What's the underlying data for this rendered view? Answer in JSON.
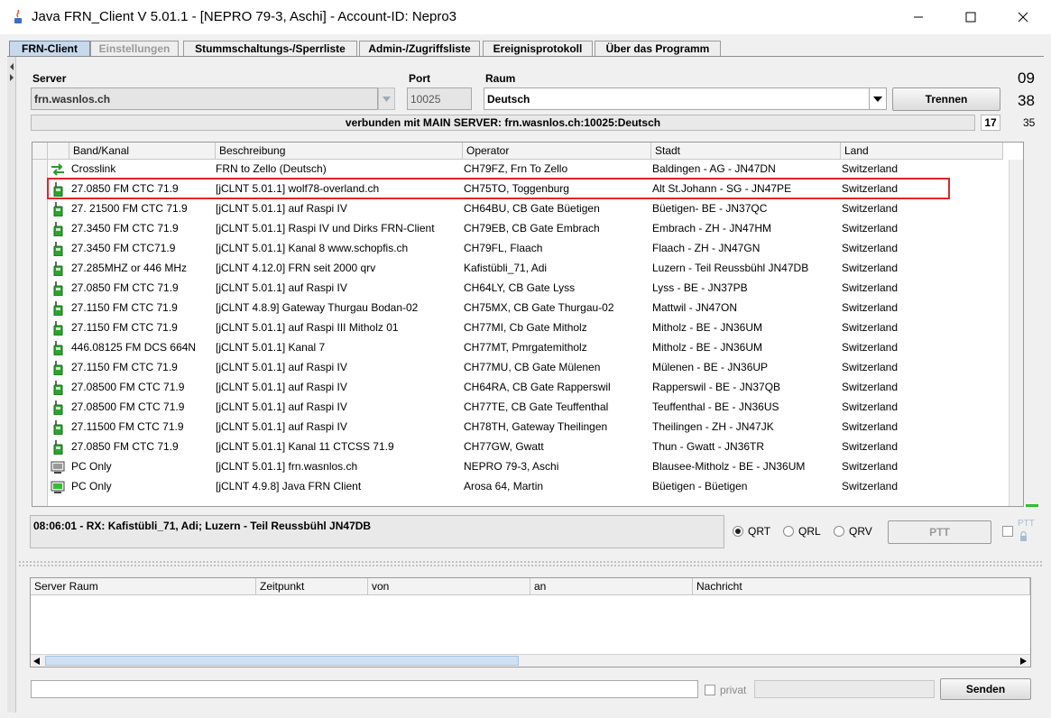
{
  "window": {
    "title": "Java FRN_Client V 5.01.1 - [NEPRO 79-3, Aschi] - Account-ID: Nepro3"
  },
  "tabs": [
    {
      "label": "FRN-Client",
      "state": "active"
    },
    {
      "label": "Einstellungen",
      "state": "disabled"
    },
    {
      "label": "Stummschaltungs-/Sperrliste",
      "state": "normal"
    },
    {
      "label": "Admin-/Zugriffsliste",
      "state": "normal"
    },
    {
      "label": "Ereignisprotokoll",
      "state": "normal"
    },
    {
      "label": "Über das Programm",
      "state": "normal"
    }
  ],
  "connection": {
    "server_label": "Server",
    "server_value": "frn.wasnlos.ch",
    "port_label": "Port",
    "port_value": "10025",
    "room_label": "Raum",
    "room_value": "Deutsch",
    "disconnect_button": "Trennen",
    "status_text": "verbunden mit  MAIN SERVER: frn.wasnlos.ch:10025:Deutsch",
    "user_count": "17",
    "clock_hours": "09",
    "clock_minutes": "38",
    "clock_seconds": "35"
  },
  "server_table": {
    "columns": [
      "Band/Kanal",
      "Beschreibung",
      "Operator",
      "Stadt",
      "Land"
    ],
    "rows": [
      {
        "icon": "crosslink-icon",
        "band": "Crosslink",
        "description": "FRN to Zello (Deutsch)",
        "operator": "CH79FZ, Frn To Zello",
        "city": "Baldingen - AG - JN47DN",
        "country": "Switzerland"
      },
      {
        "icon": "radio-gateway-icon",
        "band": "27.0850 FM CTC 71.9",
        "description": "[jCLNT 5.01.1] wolf78-overland.ch",
        "operator": "CH75TO, Toggenburg",
        "city": "Alt St.Johann - SG - JN47PE",
        "country": "Switzerland"
      },
      {
        "icon": "radio-gateway-icon",
        "band": "27. 21500 FM CTC 71.9",
        "description": "[jCLNT 5.01.1] auf Raspi IV",
        "operator": "CH64BU, CB Gate Büetigen",
        "city": "Büetigen- BE - JN37QC",
        "country": "Switzerland"
      },
      {
        "icon": "radio-gateway-icon",
        "band": "27.3450 FM CTC 71.9",
        "description": "[jCLNT 5.01.1] Raspi IV und Dirks FRN-Client",
        "operator": "CH79EB, CB Gate Embrach",
        "city": "Embrach - ZH - JN47HM",
        "country": "Switzerland"
      },
      {
        "icon": "radio-gateway-icon",
        "band": "27.3450 FM CTC71.9",
        "description": "[jCLNT 5.01.1] Kanal 8  www.schopfis.ch",
        "operator": "CH79FL, Flaach",
        "city": "Flaach - ZH - JN47GN",
        "country": "Switzerland"
      },
      {
        "icon": "radio-gateway-icon",
        "band": "27.285MHZ or 446 MHz",
        "description": "[jCLNT 4.12.0] FRN seit 2000 qrv",
        "operator": "Kafistübli_71, Adi",
        "city": "Luzern - Teil Reussbühl JN47DB",
        "country": "Switzerland"
      },
      {
        "icon": "radio-gateway-icon",
        "band": "27.0850 FM CTC 71.9",
        "description": "[jCLNT 5.01.1] auf Raspi IV",
        "operator": "CH64LY, CB Gate Lyss",
        "city": "Lyss - BE - JN37PB",
        "country": "Switzerland"
      },
      {
        "icon": "radio-gateway-icon",
        "band": "27.1150 FM CTC 71.9",
        "description": "[jCLNT 4.8.9] Gateway Thurgau Bodan-02",
        "operator": "CH75MX, CB Gate Thurgau-02",
        "city": "Mattwil - JN47ON",
        "country": "Switzerland"
      },
      {
        "icon": "radio-gateway-icon",
        "band": "27.1150 FM CTC 71.9",
        "description": "[jCLNT 5.01.1] auf Raspi III  Mitholz 01",
        "operator": "CH77MI, Cb Gate Mitholz",
        "city": "Mitholz - BE - JN36UM",
        "country": "Switzerland"
      },
      {
        "icon": "radio-gateway-icon",
        "band": "446.08125 FM DCS 664N",
        "description": "[jCLNT 5.01.1] Kanal 7",
        "operator": "CH77MT, Pmrgatemitholz",
        "city": "Mitholz - BE - JN36UM",
        "country": "Switzerland"
      },
      {
        "icon": "radio-gateway-icon",
        "band": "27.1150 FM CTC 71.9",
        "description": "[jCLNT 5.01.1] auf Raspi IV",
        "operator": "CH77MU, CB Gate Mülenen",
        "city": "Mülenen - BE - JN36UP",
        "country": "Switzerland"
      },
      {
        "icon": "radio-gateway-icon",
        "band": "27.08500 FM CTC 71.9",
        "description": "[jCLNT 5.01.1] auf Raspi IV",
        "operator": "CH64RA, CB Gate Rapperswil",
        "city": "Rapperswil - BE - JN37QB",
        "country": "Switzerland"
      },
      {
        "icon": "radio-gateway-icon",
        "band": "27.08500 FM CTC 71.9",
        "description": "[jCLNT 5.01.1] auf Raspi IV",
        "operator": "CH77TE, CB Gate Teuffenthal",
        "city": "Teuffenthal - BE - JN36US",
        "country": "Switzerland"
      },
      {
        "icon": "radio-gateway-icon",
        "band": "27.11500 FM CTC 71.9",
        "description": "[jCLNT 5.01.1] auf Raspi IV",
        "operator": "CH78TH, Gateway Theilingen",
        "city": "Theilingen - ZH - JN47JK",
        "country": "Switzerland"
      },
      {
        "icon": "radio-gateway-icon",
        "band": "27.0850 FM CTC 71.9",
        "description": "[jCLNT 5.01.1] Kanal 11 CTCSS 71.9",
        "operator": "CH77GW, Gwatt",
        "city": "Thun - Gwatt - JN36TR",
        "country": "Switzerland"
      },
      {
        "icon": "pc-gray-icon",
        "band": "PC Only",
        "description": "[jCLNT 5.01.1] frn.wasnlos.ch",
        "operator": "NEPRO 79-3, Aschi",
        "city": "Blausee-Mitholz - BE - JN36UM",
        "country": "Switzerland"
      },
      {
        "icon": "pc-green-icon",
        "band": "PC Only",
        "description": "[jCLNT 4.9.8] Java FRN Client",
        "operator": "Arosa 64, Martin",
        "city": "Büetigen - Büetigen",
        "country": "Switzerland"
      }
    ]
  },
  "last_rx": "08:06:01 - RX: Kafistübli_71, Adi;  Luzern - Teil Reussbühl JN47DB",
  "modes": [
    {
      "label": "QRT",
      "selected": true
    },
    {
      "label": "QRL",
      "selected": false
    },
    {
      "label": "QRV",
      "selected": false
    }
  ],
  "ptt_button": "PTT",
  "ptt_lock_label": "PTT",
  "message_table": {
    "columns": [
      "Server Raum",
      "Zeitpunkt",
      "von",
      "an",
      "Nachricht"
    ]
  },
  "message_input": {
    "value": ""
  },
  "private_label": "privat",
  "send_button": "Senden"
}
